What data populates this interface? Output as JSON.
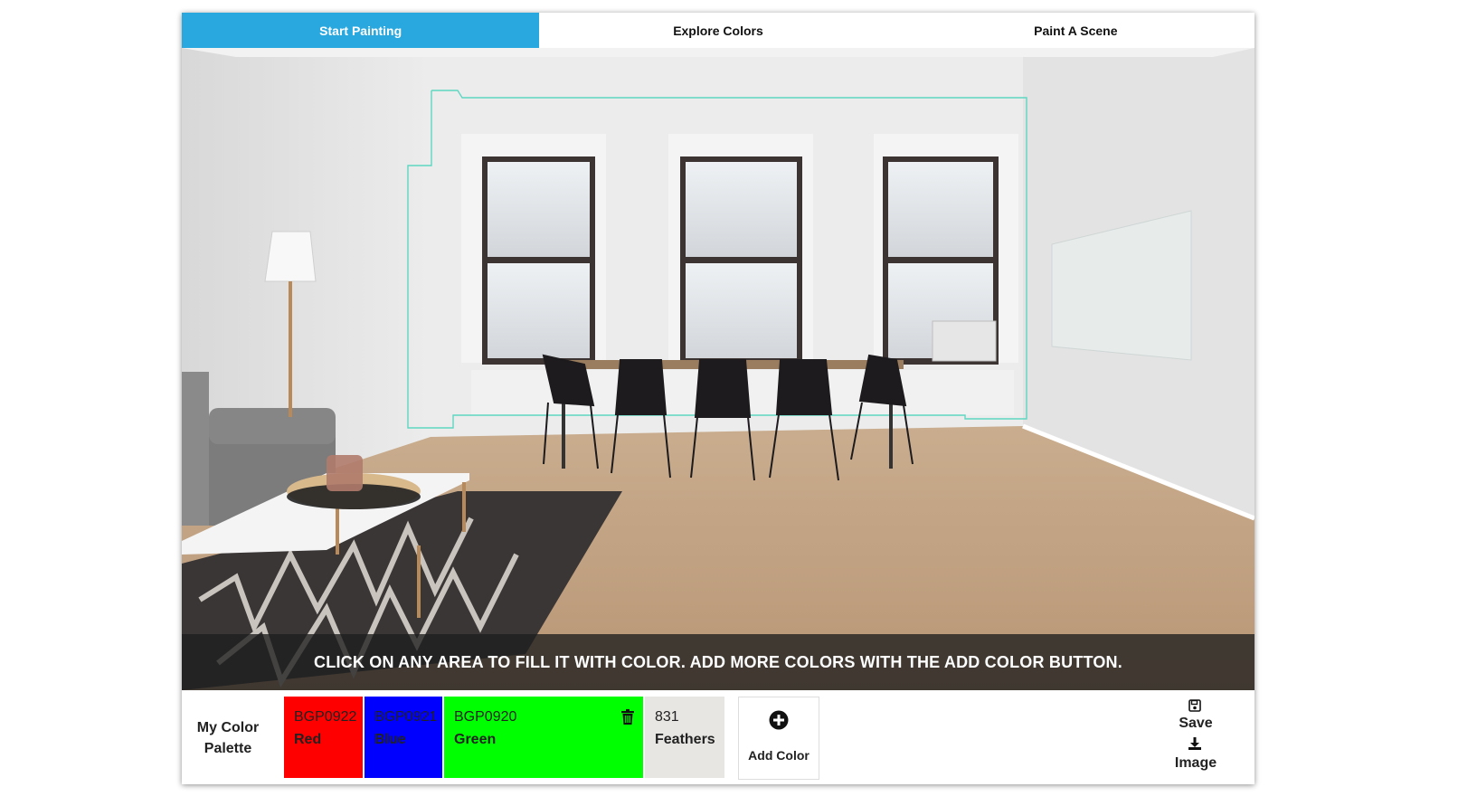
{
  "tabs": [
    {
      "label": "Start Painting",
      "active": true
    },
    {
      "label": "Explore Colors",
      "active": false
    },
    {
      "label": "Paint A Scene",
      "active": false
    }
  ],
  "scene": {
    "hint": "CLICK ON ANY AREA TO FILL IT WITH COLOR. ADD MORE COLORS WITH THE ADD COLOR BUTTON.",
    "outline_color": "#5fd7c2"
  },
  "palette": {
    "title": "My Color Palette",
    "colors": [
      {
        "code": "BGP0922",
        "name": "Red",
        "hex": "#ff0000"
      },
      {
        "code": "BGP0921",
        "name": "Blue",
        "hex": "#0000ff"
      },
      {
        "code": "BGP0920",
        "name": "Green",
        "hex": "#00ff00",
        "selected": true
      },
      {
        "code": "831",
        "name": "Feathers",
        "hex": "#e8e6e3"
      }
    ],
    "add_label": "Add Color",
    "save_label": "Save",
    "image_label": "Image"
  },
  "colors": {
    "accent": "#29a8e0"
  }
}
